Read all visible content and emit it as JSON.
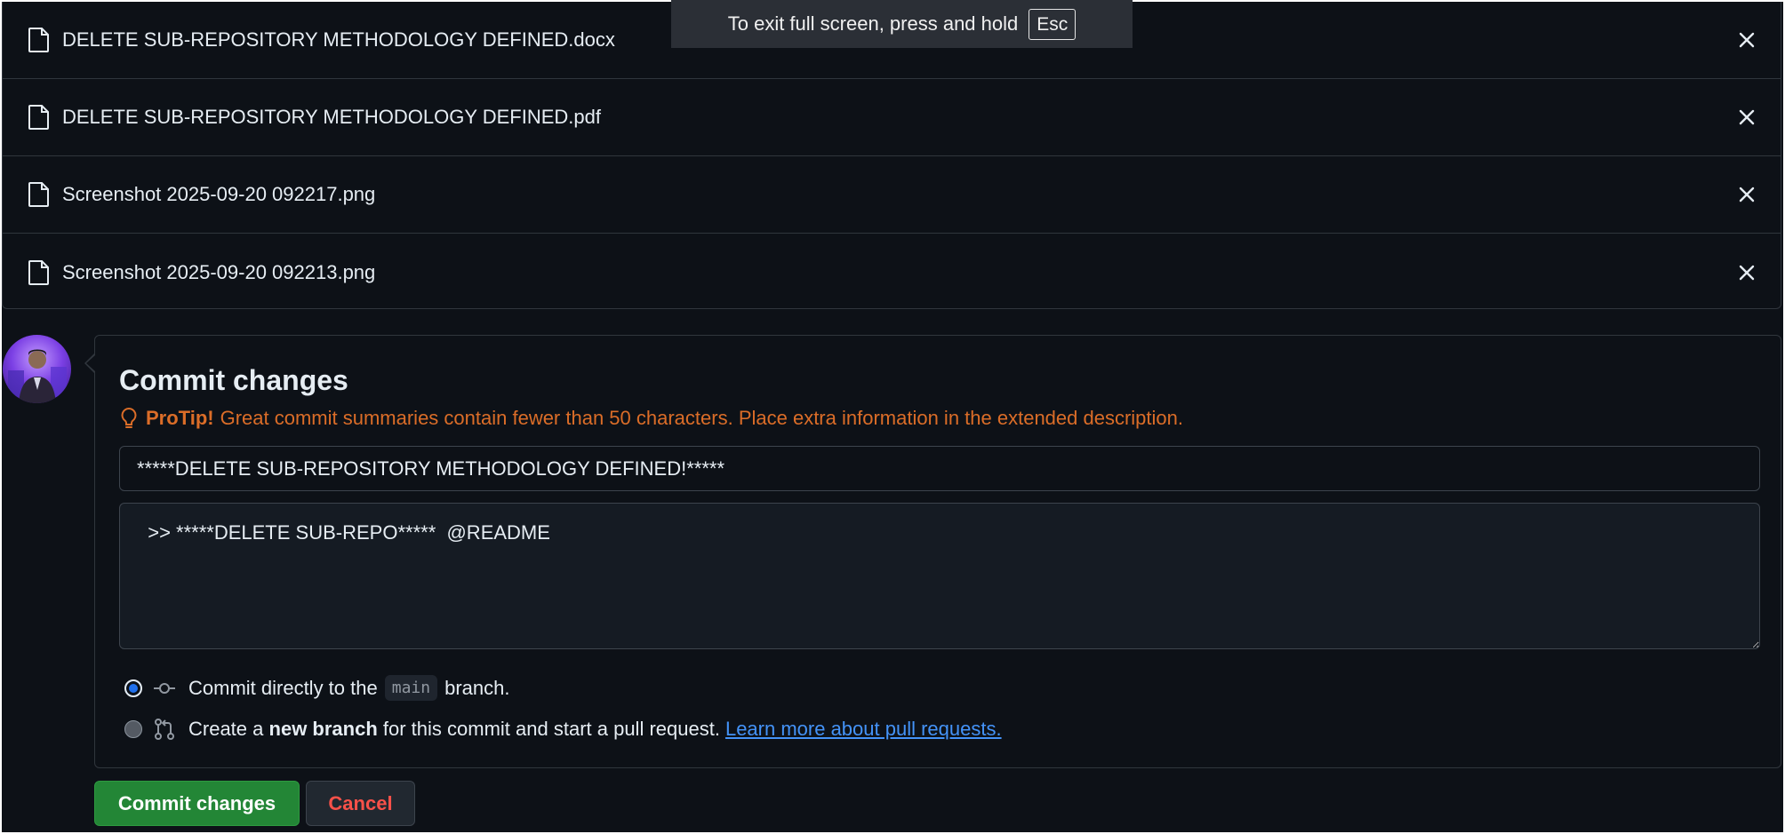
{
  "fullscreen_toast": {
    "text": "To exit full screen, press and hold",
    "key": "Esc"
  },
  "files": [
    {
      "name": "DELETE SUB-REPOSITORY METHODOLOGY DEFINED.docx"
    },
    {
      "name": "DELETE SUB-REPOSITORY METHODOLOGY DEFINED.pdf"
    },
    {
      "name": "Screenshot 2025-09-20 092217.png"
    },
    {
      "name": "Screenshot 2025-09-20 092213.png"
    }
  ],
  "commit": {
    "title": "Commit changes",
    "protip_label": "ProTip!",
    "protip_text": "Great commit summaries contain fewer than 50 characters. Place extra information in the extended description.",
    "summary_value": "*****DELETE SUB-REPOSITORY METHODOLOGY DEFINED!*****",
    "description_value": "  >> *****DELETE SUB-REPO*****  @README",
    "options": {
      "direct": {
        "prefix": "Commit directly to the",
        "branch": "main",
        "suffix": "branch.",
        "selected": true
      },
      "new_branch": {
        "prefix": "Create a",
        "bold": "new branch",
        "suffix": "for this commit and start a pull request.",
        "link": "Learn more about pull requests.",
        "selected": false
      }
    }
  },
  "buttons": {
    "commit": "Commit changes",
    "cancel": "Cancel"
  },
  "colors": {
    "background": "#0d1117",
    "border": "#30363d",
    "protip": "#db6d28",
    "commit_button": "#238636",
    "cancel_text": "#f85149",
    "link": "#4493f8"
  },
  "icons": {
    "file": "file-icon",
    "remove": "close-icon",
    "protip": "light-bulb-icon",
    "commit": "git-commit-icon",
    "pull_request": "git-pull-request-icon"
  }
}
